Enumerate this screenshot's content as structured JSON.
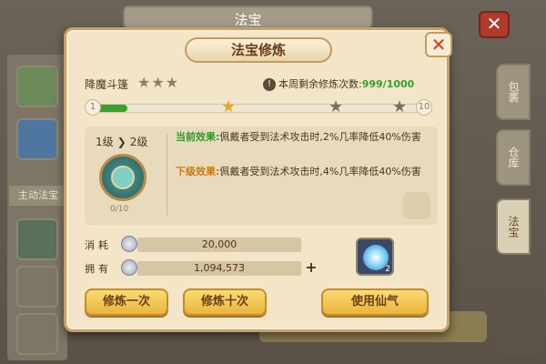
{
  "background": {
    "window_title": "法宝",
    "close_label": "✕",
    "left_label": "主动法宝",
    "tabs": [
      "包裹",
      "仓库",
      "法宝"
    ]
  },
  "dialog": {
    "title": "法宝修炼",
    "close_label": "✕",
    "item_name": "降魔斗篷",
    "star_count": 3,
    "remaining_label": "本周剩余修炼次数:",
    "remaining_value": "999/1000",
    "progress": {
      "start_level": "1",
      "end_level": "10",
      "fill_fraction": 0.1
    },
    "level": {
      "from": "1级",
      "to": "2级"
    },
    "exp": "0/10",
    "current_effect": {
      "tag": "当前效果:",
      "text": "佩戴者受到法术攻击时,2%几率降低40%伤害"
    },
    "next_effect": {
      "tag": "下级效果:",
      "text": "佩戴者受到法术攻击时,4%几率降低40%伤害"
    },
    "consume": {
      "label": "消耗",
      "value": "20,000"
    },
    "own": {
      "label": "拥有",
      "value": "1,094,573"
    },
    "qi_count": "2",
    "buttons": {
      "train_once": "修炼一次",
      "train_ten": "修炼十次",
      "use_qi": "使用仙气"
    }
  },
  "colors": {
    "accent_green": "#35a12d",
    "button_gold": "#eab43c",
    "close_red": "#d13a22"
  }
}
